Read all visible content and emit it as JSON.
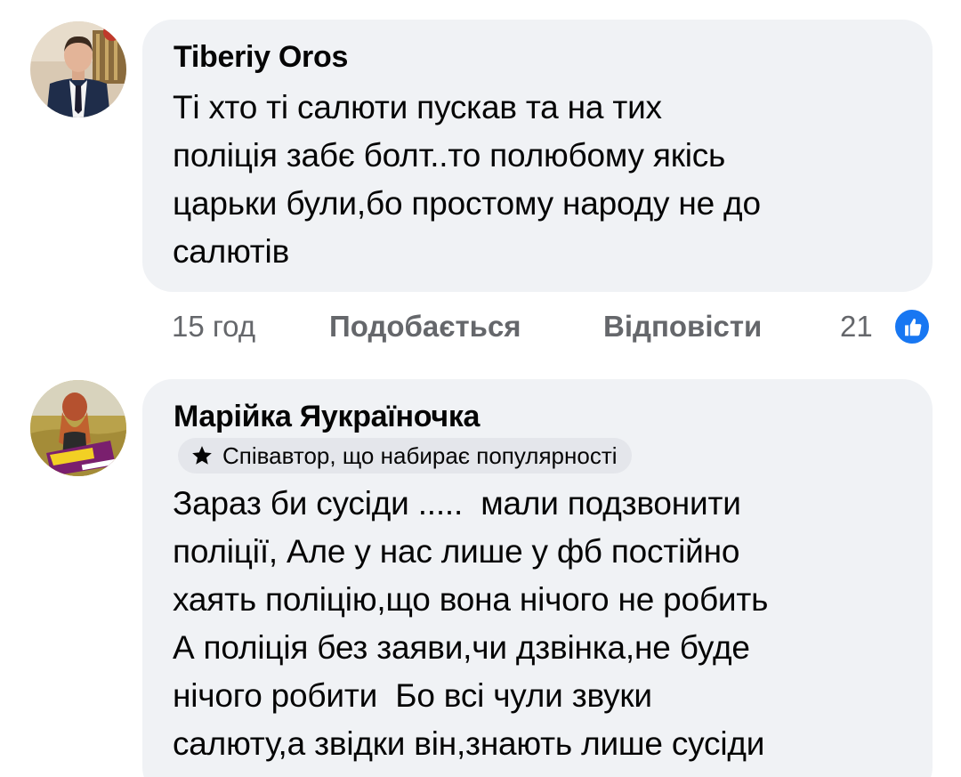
{
  "comments": [
    {
      "author": "Tiberiy Oros",
      "text_lines": [
        "Ті хто ті салюти пускав та на тих",
        "поліція забє болт..то полюбому якісь",
        "царьки були,бо простому народу не до",
        "салютів"
      ],
      "time": "15 год",
      "like_label": "Подобається",
      "reply_label": "Відповісти",
      "reaction_count": "21",
      "reaction_icon": "like-icon",
      "avatar_icon": "profile-photo-man-in-suit"
    },
    {
      "author": "Марійка Яукраїночка",
      "badge": {
        "icon": "star-icon",
        "label": "Співавтор, що набирає популярності"
      },
      "text_lines": [
        "Зараз би сусіди .....  мали подзвонити",
        "поліції, Але у нас лише у фб постійно",
        "хаять поліцію,що вона нічого не робить",
        "А поліція без заяви,чи дзвінка,не буде",
        "нічого робити  Бо всі чули звуки",
        "салюту,а звідки він,знають лише сусіди"
      ],
      "avatar_icon": "profile-photo-woman-in-field"
    }
  ],
  "colors": {
    "bubble": "#f0f2f5",
    "meta_text": "#65676b",
    "like_blue": "#1877f2",
    "badge_bg": "#e4e6eb"
  }
}
